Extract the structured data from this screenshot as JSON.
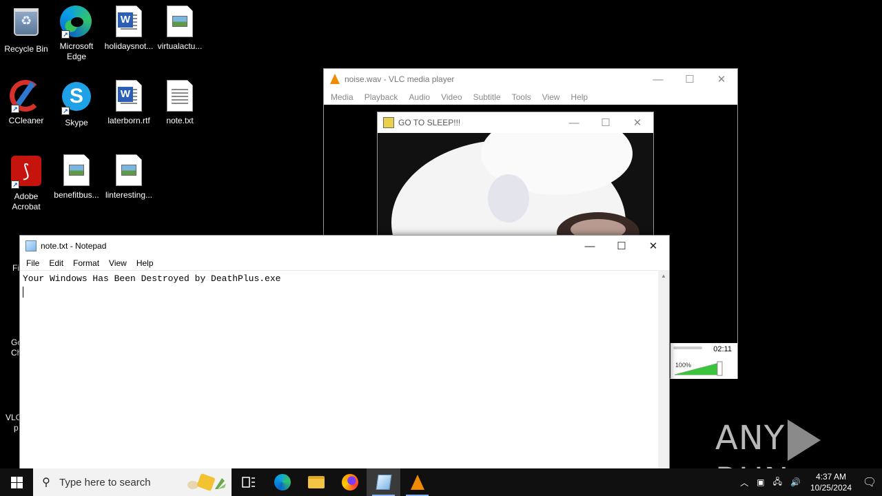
{
  "desktop": {
    "icons": [
      {
        "label": "Recycle Bin",
        "icon": "recycle-bin-icon"
      },
      {
        "label": "Microsoft Edge",
        "icon": "edge-icon"
      },
      {
        "label": "holidaysnot...",
        "icon": "word-document-icon"
      },
      {
        "label": "virtualactu...",
        "icon": "image-file-icon"
      },
      {
        "label": "CCleaner",
        "icon": "ccleaner-icon"
      },
      {
        "label": "Skype",
        "icon": "skype-icon"
      },
      {
        "label": "laterborn.rtf",
        "icon": "word-document-icon"
      },
      {
        "label": "note.txt",
        "icon": "text-file-icon"
      },
      {
        "label": "Adobe Acrobat",
        "icon": "acrobat-icon"
      },
      {
        "label": "benefitbus...",
        "icon": "image-file-icon"
      },
      {
        "label": "linteresting...",
        "icon": "image-file-icon"
      }
    ],
    "partial_labels": [
      "Fi",
      "Go",
      "Ch",
      "VLC",
      "p"
    ]
  },
  "vlc": {
    "title": "noise.wav - VLC media player",
    "menu": [
      "Media",
      "Playback",
      "Audio",
      "Video",
      "Subtitle",
      "Tools",
      "View",
      "Help"
    ],
    "time": "02:11",
    "volume_label": "100%",
    "volume_level": 1.0
  },
  "sleep_window": {
    "title": "GO TO SLEEP!!!"
  },
  "notepad": {
    "title": "note.txt - Notepad",
    "menu": [
      "File",
      "Edit",
      "Format",
      "View",
      "Help"
    ],
    "content": "Your Windows Has Been Destroyed by DeathPlus.exe"
  },
  "taskbar": {
    "search_placeholder": "Type here to search",
    "time": "4:37 AM",
    "date": "10/25/2024"
  },
  "watermark": {
    "left": "ANY",
    "right": "RUN"
  },
  "colors": {
    "accent": "#1c5fc8",
    "vlc_orange": "#f08a00",
    "volume_green": "#3cc43c"
  }
}
